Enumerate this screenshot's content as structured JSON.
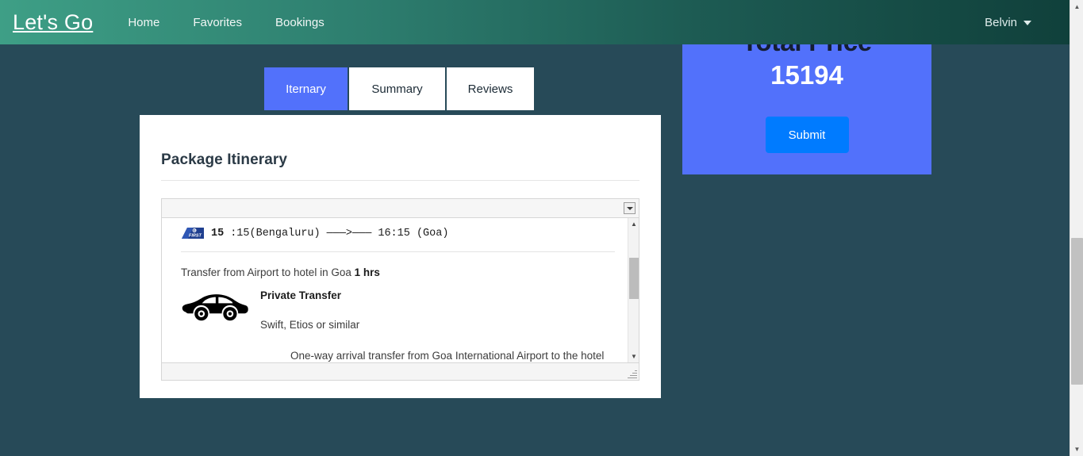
{
  "navbar": {
    "brand": "Let's Go",
    "links": [
      {
        "label": "Home"
      },
      {
        "label": "Favorites"
      },
      {
        "label": "Bookings"
      }
    ],
    "user": {
      "name": "Belvin",
      "caret_icon": "chevron-down-icon"
    },
    "gradient_from": "#3e9f86",
    "gradient_to": "#10403b"
  },
  "page": {
    "background_color": "#274a58"
  },
  "tabs": [
    {
      "label": "Iternary",
      "active": true
    },
    {
      "label": "Summary",
      "active": false
    },
    {
      "label": "Reviews",
      "active": false
    }
  ],
  "card": {
    "title": "Package Itinerary"
  },
  "itinerary_panel": {
    "titlebar": {
      "dropdown_icon": "caret-down-icon"
    },
    "flight": {
      "airline_logo": "go-first-airline-logo",
      "logo_text": "FIRST",
      "depart_time": "15",
      "depart_time_rest": ":15(Bengaluru)",
      "arrow": "———>———",
      "arrive": "16:15  (Goa)"
    },
    "transfer": {
      "headline_text": "Transfer from Airport to hotel in Goa ",
      "headline_duration": "1 hrs",
      "car_icon": "car-icon",
      "title": "Private Transfer",
      "subtitle": "Swift, Etios or similar",
      "description": "One-way arrival transfer from Goa International Airport to the hotel in any location in North and South Goa"
    },
    "scrollbar": {
      "up_arrow": "▲",
      "down_arrow": "▼"
    },
    "resize_grip": "resize-grip-icon"
  },
  "price_panel": {
    "label": "Total Price",
    "value": "15194",
    "submit_label": "Submit",
    "panel_color": "#5271fb",
    "button_color": "#007bff"
  },
  "page_scrollbar": {
    "up_arrow": "▲",
    "down_arrow": "▼"
  }
}
